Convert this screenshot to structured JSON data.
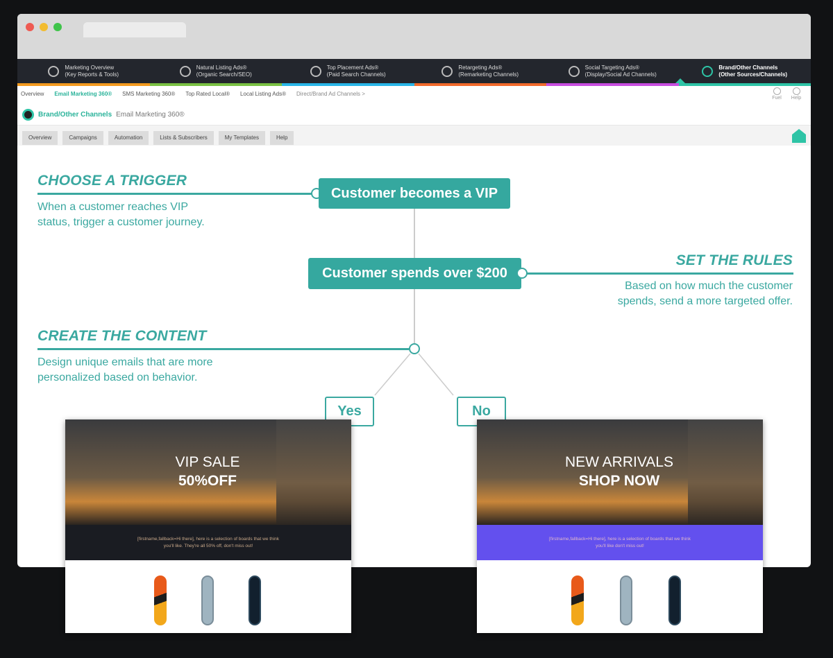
{
  "nav": [
    {
      "title": "Marketing Overview",
      "sub": "(Key Reports & Tools)",
      "icon": "chart-icon"
    },
    {
      "title": "Natural Listing Ads®",
      "sub": "(Organic Search/SEO)",
      "icon": "chevrons-down-icon"
    },
    {
      "title": "Top Placement Ads®",
      "sub": "(Paid Search Channels)",
      "icon": "chevrons-up-icon"
    },
    {
      "title": "Retargeting Ads®",
      "sub": "(Remarketing Channels)",
      "icon": "retarget-icon"
    },
    {
      "title": "Social Targeting Ads®",
      "sub": "(Display/Social Ad Channels)",
      "icon": "social-icon"
    },
    {
      "title": "Brand/Other Channels",
      "sub": "(Other Sources/Channels)",
      "icon": "target-icon"
    }
  ],
  "nav_colors": [
    "#f39a1e",
    "#7ac143",
    "#29b6e8",
    "#f26a2c",
    "#c84de0",
    "#2ec4a6"
  ],
  "subnav": [
    "Overview",
    "Email Marketing 360®",
    "SMS Marketing 360®",
    "Top Rated Local®",
    "Local Listing Ads®",
    "Direct/Brand Ad Channels >"
  ],
  "util": {
    "fuel": "Fuel",
    "help": "Help"
  },
  "brand": {
    "title": "Brand/Other Channels",
    "sub": "Email Marketing 360®"
  },
  "tabs": [
    "Overview",
    "Campaigns",
    "Automation",
    "Lists & Subscribers",
    "My Templates",
    "Help"
  ],
  "flow": {
    "trigger_heading": "CHOOSE A TRIGGER",
    "trigger_text": "When a customer reaches VIP status, trigger a customer journey.",
    "node1": "Customer becomes a VIP",
    "rules_heading": "SET THE RULES",
    "rules_text": "Based on how much the customer spends, send a more targeted offer.",
    "node2": "Customer spends over $200",
    "content_heading": "CREATE THE CONTENT",
    "content_text": "Design unique emails that are more personalized based on behavior.",
    "yes": "Yes",
    "no": "No"
  },
  "cards": [
    {
      "line1": "VIP SALE",
      "line2": "50%OFF",
      "body": "[firstname,fallback=Hi there], here is a selection of boards that we think you'll like. They're all 50% off, don't miss out!",
      "band": "#1a1c22"
    },
    {
      "line1": "NEW ARRIVALS",
      "line2": "SHOP NOW",
      "body": "[firstname,fallback=Hi there], here is a selection of boards that we think you'll like don't miss out!",
      "band": "#6350ee"
    }
  ],
  "accent": "#3aa8a0"
}
